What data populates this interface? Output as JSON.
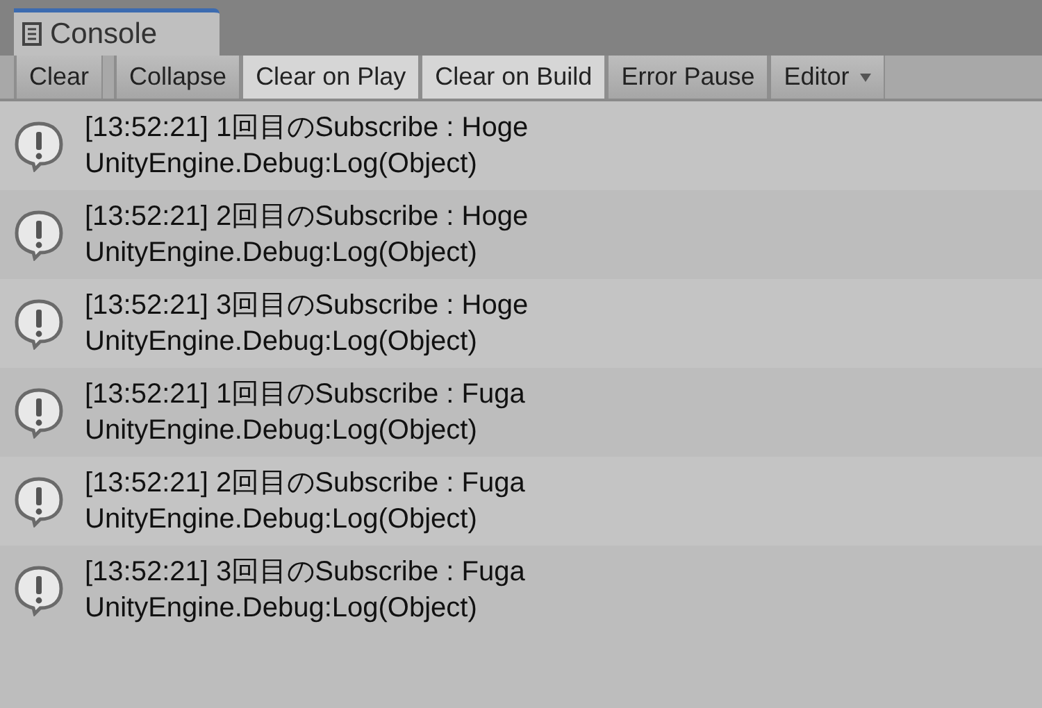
{
  "tab": {
    "title": "Console"
  },
  "toolbar": [
    {
      "label": "Clear",
      "kind": "button",
      "selected": false
    },
    {
      "label": "Collapse",
      "kind": "button",
      "selected": false
    },
    {
      "label": "Clear on Play",
      "kind": "button",
      "selected": true
    },
    {
      "label": "Clear on Build",
      "kind": "button",
      "selected": true
    },
    {
      "label": "Error Pause",
      "kind": "button",
      "selected": false
    },
    {
      "label": "Editor",
      "kind": "dropdown",
      "selected": false
    }
  ],
  "log": [
    {
      "message": "[13:52:21] 1回目のSubscribe : Hoge",
      "trace": "UnityEngine.Debug:Log(Object)"
    },
    {
      "message": "[13:52:21] 2回目のSubscribe : Hoge",
      "trace": "UnityEngine.Debug:Log(Object)"
    },
    {
      "message": "[13:52:21] 3回目のSubscribe : Hoge",
      "trace": "UnityEngine.Debug:Log(Object)"
    },
    {
      "message": "[13:52:21] 1回目のSubscribe : Fuga",
      "trace": "UnityEngine.Debug:Log(Object)"
    },
    {
      "message": "[13:52:21] 2回目のSubscribe : Fuga",
      "trace": "UnityEngine.Debug:Log(Object)"
    },
    {
      "message": "[13:52:21] 3回目のSubscribe : Fuga",
      "trace": "UnityEngine.Debug:Log(Object)"
    }
  ]
}
